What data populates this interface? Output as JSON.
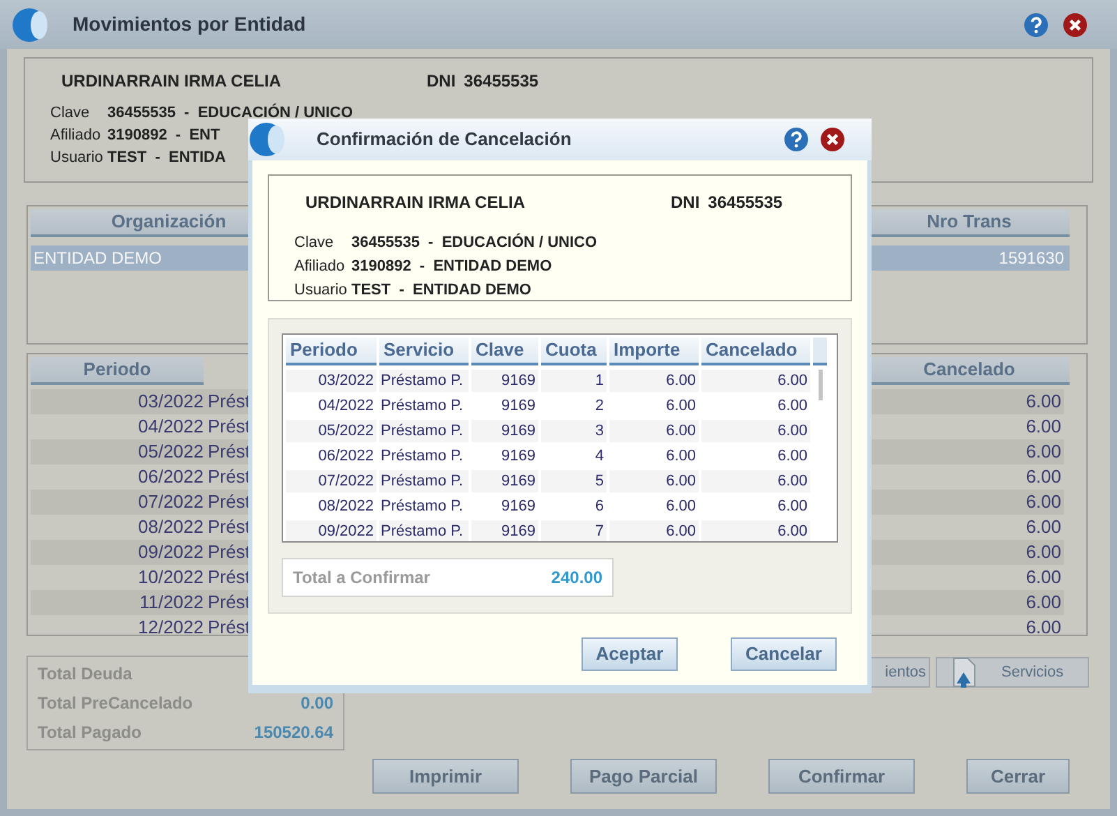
{
  "window": {
    "title": "Movimientos por Entidad"
  },
  "info": {
    "name": "URDINARRAIN IRMA CELIA",
    "dni_label": "DNI",
    "dni": "36455535",
    "rows": [
      {
        "label": "Clave",
        "value": "36455535  -  EDUCACIÓN / UNICO"
      },
      {
        "label": "Afiliado",
        "value": "3190892  -  ENT"
      },
      {
        "label": "Usuario",
        "value": "TEST  -  ENTIDA"
      }
    ]
  },
  "organizations": {
    "columns": [
      "Organización",
      "Nro Trans"
    ],
    "rows": [
      {
        "entity": "ENTIDAD DEMO",
        "number": "1591630",
        "selected": true
      }
    ]
  },
  "movements": {
    "columns": [
      "Periodo",
      "Cancelado"
    ],
    "rows": [
      {
        "periodo": "03/2022",
        "servicio": "Prést",
        "cancelado": "6.00"
      },
      {
        "periodo": "04/2022",
        "servicio": "Prést",
        "cancelado": "6.00"
      },
      {
        "periodo": "05/2022",
        "servicio": "Prést",
        "cancelado": "6.00"
      },
      {
        "periodo": "06/2022",
        "servicio": "Prést",
        "cancelado": "6.00"
      },
      {
        "periodo": "07/2022",
        "servicio": "Prést",
        "cancelado": "6.00"
      },
      {
        "periodo": "08/2022",
        "servicio": "Prést",
        "cancelado": "6.00"
      },
      {
        "periodo": "09/2022",
        "servicio": "Prést",
        "cancelado": "6.00"
      },
      {
        "periodo": "10/2022",
        "servicio": "Prést",
        "cancelado": "6.00"
      },
      {
        "periodo": "11/2022",
        "servicio": "Prést",
        "cancelado": "6.00"
      },
      {
        "periodo": "12/2022",
        "servicio": "Prést",
        "cancelado": "6.00"
      }
    ]
  },
  "totals": [
    {
      "label": "Total Deuda"
    },
    {
      "label": "Total PreCancelado",
      "value": "0.00"
    },
    {
      "label": "Total Pagado",
      "value": "150520.64"
    }
  ],
  "side_buttons": [
    {
      "label": "ientos",
      "kind": "plain"
    },
    {
      "label": "Servicios",
      "kind": "icon"
    }
  ],
  "buttons": [
    "Imprimir",
    "Pago Parcial",
    "Confirmar",
    "Cerrar"
  ],
  "dialog": {
    "title": "Confirmación de Cancelación",
    "info": {
      "name": "URDINARRAIN IRMA CELIA",
      "dni_label": "DNI",
      "dni": "36455535",
      "rows": [
        {
          "label": "Clave",
          "value": "36455535  -  EDUCACIÓN / UNICO"
        },
        {
          "label": "Afiliado",
          "value": "3190892  -  ENTIDAD DEMO"
        },
        {
          "label": "Usuario",
          "value": "TEST  -  ENTIDAD DEMO"
        }
      ]
    },
    "table": {
      "columns": [
        "Periodo",
        "Servicio",
        "Clave",
        "Cuota",
        "Importe",
        "Cancelado"
      ],
      "rows": [
        [
          "03/2022",
          "Préstamo P.",
          "9169",
          "1",
          "6.00",
          "6.00"
        ],
        [
          "04/2022",
          "Préstamo P.",
          "9169",
          "2",
          "6.00",
          "6.00"
        ],
        [
          "05/2022",
          "Préstamo P.",
          "9169",
          "3",
          "6.00",
          "6.00"
        ],
        [
          "06/2022",
          "Préstamo P.",
          "9169",
          "4",
          "6.00",
          "6.00"
        ],
        [
          "07/2022",
          "Préstamo P.",
          "9169",
          "5",
          "6.00",
          "6.00"
        ],
        [
          "08/2022",
          "Préstamo P.",
          "9169",
          "6",
          "6.00",
          "6.00"
        ],
        [
          "09/2022",
          "Préstamo P.",
          "9169",
          "7",
          "6.00",
          "6.00"
        ]
      ]
    },
    "total": {
      "label": "Total a Confirmar",
      "value": "240.00"
    },
    "buttons": [
      "Aceptar",
      "Cancelar"
    ]
  }
}
